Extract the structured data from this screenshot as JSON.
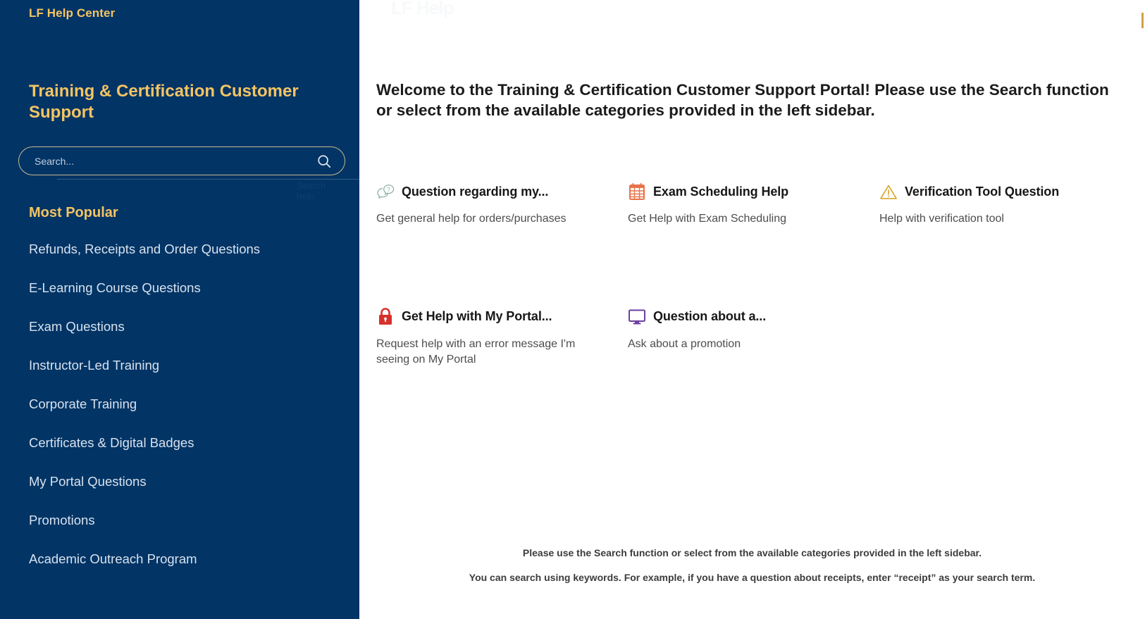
{
  "sidebar": {
    "logo": "LF Help Center",
    "title": "Training & Certification Customer Support",
    "search": {
      "placeholder": "Search...",
      "value": "",
      "icon": "search-icon",
      "help_label": "Search help"
    },
    "section_heading": "Most Popular",
    "items": [
      {
        "label": "Refunds, Receipts and Order Questions"
      },
      {
        "label": "E-Learning Course Questions"
      },
      {
        "label": "Exam Questions"
      },
      {
        "label": "Instructor-Led Training"
      },
      {
        "label": "Corporate Training"
      },
      {
        "label": "Certificates & Digital Badges"
      },
      {
        "label": "My Portal Questions"
      },
      {
        "label": "Promotions"
      },
      {
        "label": "Academic Outreach Program"
      }
    ]
  },
  "main": {
    "watermark": "LF Help",
    "welcome": "Welcome to the Training & Certification Customer Support Portal!\nPlease use the Search function or select from the available categories provided in the left sidebar.",
    "cards": [
      {
        "icon": "question-speech-bubble-icon",
        "icon_color": "#8fb4a3",
        "title": "Question regarding my...",
        "desc": "Get general help for orders/purchases"
      },
      {
        "icon": "calendar-icon",
        "icon_color": "#e8734a",
        "title": "Exam Scheduling Help",
        "desc": "Get Help with Exam Scheduling"
      },
      {
        "icon": "warning-triangle-icon",
        "icon_color": "#d8a62e",
        "title": "Verification Tool Question",
        "desc": "Help with verification tool"
      },
      {
        "icon": "lock-icon",
        "icon_color": "#d6312b",
        "title": "Get Help with My Portal...",
        "desc": "Request help with an error message I'm seeing on My Portal"
      },
      {
        "icon": "monitor-icon",
        "icon_color": "#6b3fa0",
        "title": "Question about a...",
        "desc": "Ask about a promotion"
      }
    ],
    "footer": {
      "line1": "Please use the Search function or select from the available categories provided in the left sidebar.",
      "line2": "You can search using keywords. For example, if you have a question about receipts, enter “receipt” as your search term."
    }
  },
  "colors": {
    "sidebar_bg": "#023465",
    "accent_gold": "#f5c463",
    "nav_text": "#d7e2ef"
  }
}
